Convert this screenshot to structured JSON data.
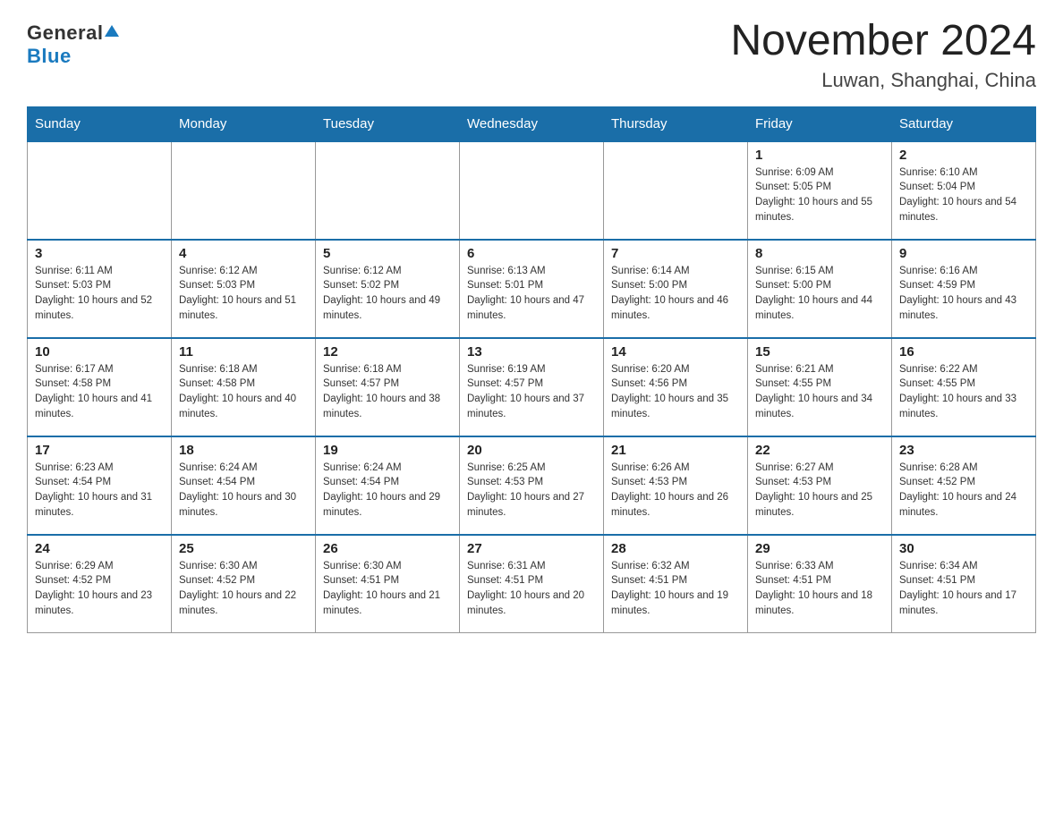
{
  "header": {
    "logo_general": "General",
    "logo_blue": "Blue",
    "title": "November 2024",
    "subtitle": "Luwan, Shanghai, China"
  },
  "weekdays": [
    "Sunday",
    "Monday",
    "Tuesday",
    "Wednesday",
    "Thursday",
    "Friday",
    "Saturday"
  ],
  "weeks": [
    [
      {
        "day": "",
        "info": ""
      },
      {
        "day": "",
        "info": ""
      },
      {
        "day": "",
        "info": ""
      },
      {
        "day": "",
        "info": ""
      },
      {
        "day": "",
        "info": ""
      },
      {
        "day": "1",
        "info": "Sunrise: 6:09 AM\nSunset: 5:05 PM\nDaylight: 10 hours and 55 minutes."
      },
      {
        "day": "2",
        "info": "Sunrise: 6:10 AM\nSunset: 5:04 PM\nDaylight: 10 hours and 54 minutes."
      }
    ],
    [
      {
        "day": "3",
        "info": "Sunrise: 6:11 AM\nSunset: 5:03 PM\nDaylight: 10 hours and 52 minutes."
      },
      {
        "day": "4",
        "info": "Sunrise: 6:12 AM\nSunset: 5:03 PM\nDaylight: 10 hours and 51 minutes."
      },
      {
        "day": "5",
        "info": "Sunrise: 6:12 AM\nSunset: 5:02 PM\nDaylight: 10 hours and 49 minutes."
      },
      {
        "day": "6",
        "info": "Sunrise: 6:13 AM\nSunset: 5:01 PM\nDaylight: 10 hours and 47 minutes."
      },
      {
        "day": "7",
        "info": "Sunrise: 6:14 AM\nSunset: 5:00 PM\nDaylight: 10 hours and 46 minutes."
      },
      {
        "day": "8",
        "info": "Sunrise: 6:15 AM\nSunset: 5:00 PM\nDaylight: 10 hours and 44 minutes."
      },
      {
        "day": "9",
        "info": "Sunrise: 6:16 AM\nSunset: 4:59 PM\nDaylight: 10 hours and 43 minutes."
      }
    ],
    [
      {
        "day": "10",
        "info": "Sunrise: 6:17 AM\nSunset: 4:58 PM\nDaylight: 10 hours and 41 minutes."
      },
      {
        "day": "11",
        "info": "Sunrise: 6:18 AM\nSunset: 4:58 PM\nDaylight: 10 hours and 40 minutes."
      },
      {
        "day": "12",
        "info": "Sunrise: 6:18 AM\nSunset: 4:57 PM\nDaylight: 10 hours and 38 minutes."
      },
      {
        "day": "13",
        "info": "Sunrise: 6:19 AM\nSunset: 4:57 PM\nDaylight: 10 hours and 37 minutes."
      },
      {
        "day": "14",
        "info": "Sunrise: 6:20 AM\nSunset: 4:56 PM\nDaylight: 10 hours and 35 minutes."
      },
      {
        "day": "15",
        "info": "Sunrise: 6:21 AM\nSunset: 4:55 PM\nDaylight: 10 hours and 34 minutes."
      },
      {
        "day": "16",
        "info": "Sunrise: 6:22 AM\nSunset: 4:55 PM\nDaylight: 10 hours and 33 minutes."
      }
    ],
    [
      {
        "day": "17",
        "info": "Sunrise: 6:23 AM\nSunset: 4:54 PM\nDaylight: 10 hours and 31 minutes."
      },
      {
        "day": "18",
        "info": "Sunrise: 6:24 AM\nSunset: 4:54 PM\nDaylight: 10 hours and 30 minutes."
      },
      {
        "day": "19",
        "info": "Sunrise: 6:24 AM\nSunset: 4:54 PM\nDaylight: 10 hours and 29 minutes."
      },
      {
        "day": "20",
        "info": "Sunrise: 6:25 AM\nSunset: 4:53 PM\nDaylight: 10 hours and 27 minutes."
      },
      {
        "day": "21",
        "info": "Sunrise: 6:26 AM\nSunset: 4:53 PM\nDaylight: 10 hours and 26 minutes."
      },
      {
        "day": "22",
        "info": "Sunrise: 6:27 AM\nSunset: 4:53 PM\nDaylight: 10 hours and 25 minutes."
      },
      {
        "day": "23",
        "info": "Sunrise: 6:28 AM\nSunset: 4:52 PM\nDaylight: 10 hours and 24 minutes."
      }
    ],
    [
      {
        "day": "24",
        "info": "Sunrise: 6:29 AM\nSunset: 4:52 PM\nDaylight: 10 hours and 23 minutes."
      },
      {
        "day": "25",
        "info": "Sunrise: 6:30 AM\nSunset: 4:52 PM\nDaylight: 10 hours and 22 minutes."
      },
      {
        "day": "26",
        "info": "Sunrise: 6:30 AM\nSunset: 4:51 PM\nDaylight: 10 hours and 21 minutes."
      },
      {
        "day": "27",
        "info": "Sunrise: 6:31 AM\nSunset: 4:51 PM\nDaylight: 10 hours and 20 minutes."
      },
      {
        "day": "28",
        "info": "Sunrise: 6:32 AM\nSunset: 4:51 PM\nDaylight: 10 hours and 19 minutes."
      },
      {
        "day": "29",
        "info": "Sunrise: 6:33 AM\nSunset: 4:51 PM\nDaylight: 10 hours and 18 minutes."
      },
      {
        "day": "30",
        "info": "Sunrise: 6:34 AM\nSunset: 4:51 PM\nDaylight: 10 hours and 17 minutes."
      }
    ]
  ]
}
